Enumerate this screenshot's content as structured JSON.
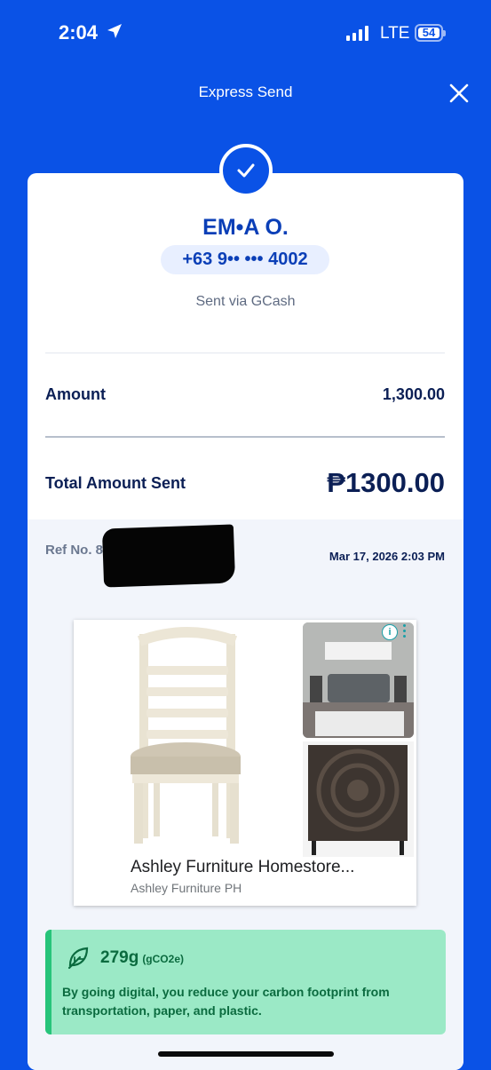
{
  "status_bar": {
    "time": "2:04",
    "network": "LTE",
    "battery": "54"
  },
  "header": {
    "title": "Express Send"
  },
  "recipient": {
    "name": "EM•A O.",
    "phone": "+63 9•• ••• 4002",
    "via": "Sent via GCash"
  },
  "amount": {
    "label": "Amount",
    "value": "1,300.00"
  },
  "total": {
    "label": "Total Amount Sent",
    "value": "₱1300.00"
  },
  "reference": {
    "label": "Ref No. 80",
    "date": "Mar 17, 2026 2:03 PM"
  },
  "ad": {
    "title": "Ashley Furniture Homestore...",
    "advertiser": "Ashley Furniture PH",
    "info_symbol": "i"
  },
  "eco": {
    "value": "279g",
    "unit": "(gCO2e)",
    "text": "By going digital, you reduce your carbon footprint from transportation, paper, and plastic."
  },
  "colors": {
    "brand": "#0a52e6",
    "name_text": "#0b3fb7",
    "eco_bg": "#9be9c6",
    "eco_text": "#0b6b3f"
  },
  "icons": [
    "location-arrow-icon",
    "signal-icon",
    "battery-icon",
    "close-icon",
    "checkmark-icon",
    "info-icon",
    "more-options-icon",
    "leaf-icon"
  ]
}
